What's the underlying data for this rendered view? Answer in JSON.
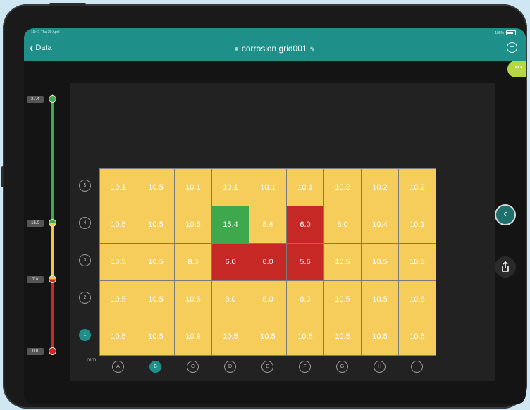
{
  "status": {
    "left_text": "10:41 Thu 20 April",
    "battery_text": "100%"
  },
  "header": {
    "back_label": "Data",
    "title": "corrosion grid001",
    "colors": {
      "accent": "#1f8f8a",
      "more": "#b5d842"
    }
  },
  "slider": {
    "thresholds": [
      "27.4",
      "15.0",
      "7.8",
      "0.0"
    ],
    "colors": {
      "good": "#3ea94c",
      "warn": "#f1c54a",
      "bad": "#c92a24"
    }
  },
  "grid": {
    "unit": "mm",
    "rows": [
      "5",
      "4",
      "3",
      "2",
      "1"
    ],
    "active_row": "1",
    "columns": [
      "A",
      "B",
      "C",
      "D",
      "E",
      "F",
      "G",
      "H",
      "I"
    ],
    "active_column": "B",
    "values": [
      [
        "10.1",
        "10.5",
        "10.1",
        "10.1",
        "10.1",
        "10.1",
        "10.2",
        "10.2",
        "10.2"
      ],
      [
        "10.5",
        "10.5",
        "10.5",
        "15.4",
        "8.4",
        "6.0",
        "8.0",
        "10.4",
        "10.1"
      ],
      [
        "10.5",
        "10.5",
        "8.0",
        "6.0",
        "6.0",
        "5.6",
        "10.5",
        "10.5",
        "10.8"
      ],
      [
        "10.5",
        "10.5",
        "10.5",
        "8.0",
        "8.0",
        "8.0",
        "10.5",
        "10.5",
        "10.5"
      ],
      [
        "10.5",
        "10.5",
        "10.9",
        "10.5",
        "10.5",
        "10.5",
        "10.5",
        "10.5",
        "10.5"
      ]
    ],
    "status": [
      [
        "y",
        "y",
        "y",
        "y",
        "y",
        "y",
        "y",
        "y",
        "y"
      ],
      [
        "y",
        "y",
        "y",
        "g",
        "y",
        "r",
        "y",
        "y",
        "y"
      ],
      [
        "y",
        "y",
        "y",
        "r",
        "r",
        "r",
        "y",
        "y",
        "y"
      ],
      [
        "y",
        "y",
        "y",
        "y",
        "y",
        "y",
        "y",
        "y",
        "y"
      ],
      [
        "y",
        "y",
        "y",
        "y",
        "y",
        "y",
        "y",
        "y",
        "y"
      ]
    ]
  },
  "icons": {
    "back": "chevron-left-icon",
    "add": "plus-circle-icon",
    "more": "ellipsis-icon",
    "collapse": "chevron-left-circle-icon",
    "share": "share-icon"
  }
}
